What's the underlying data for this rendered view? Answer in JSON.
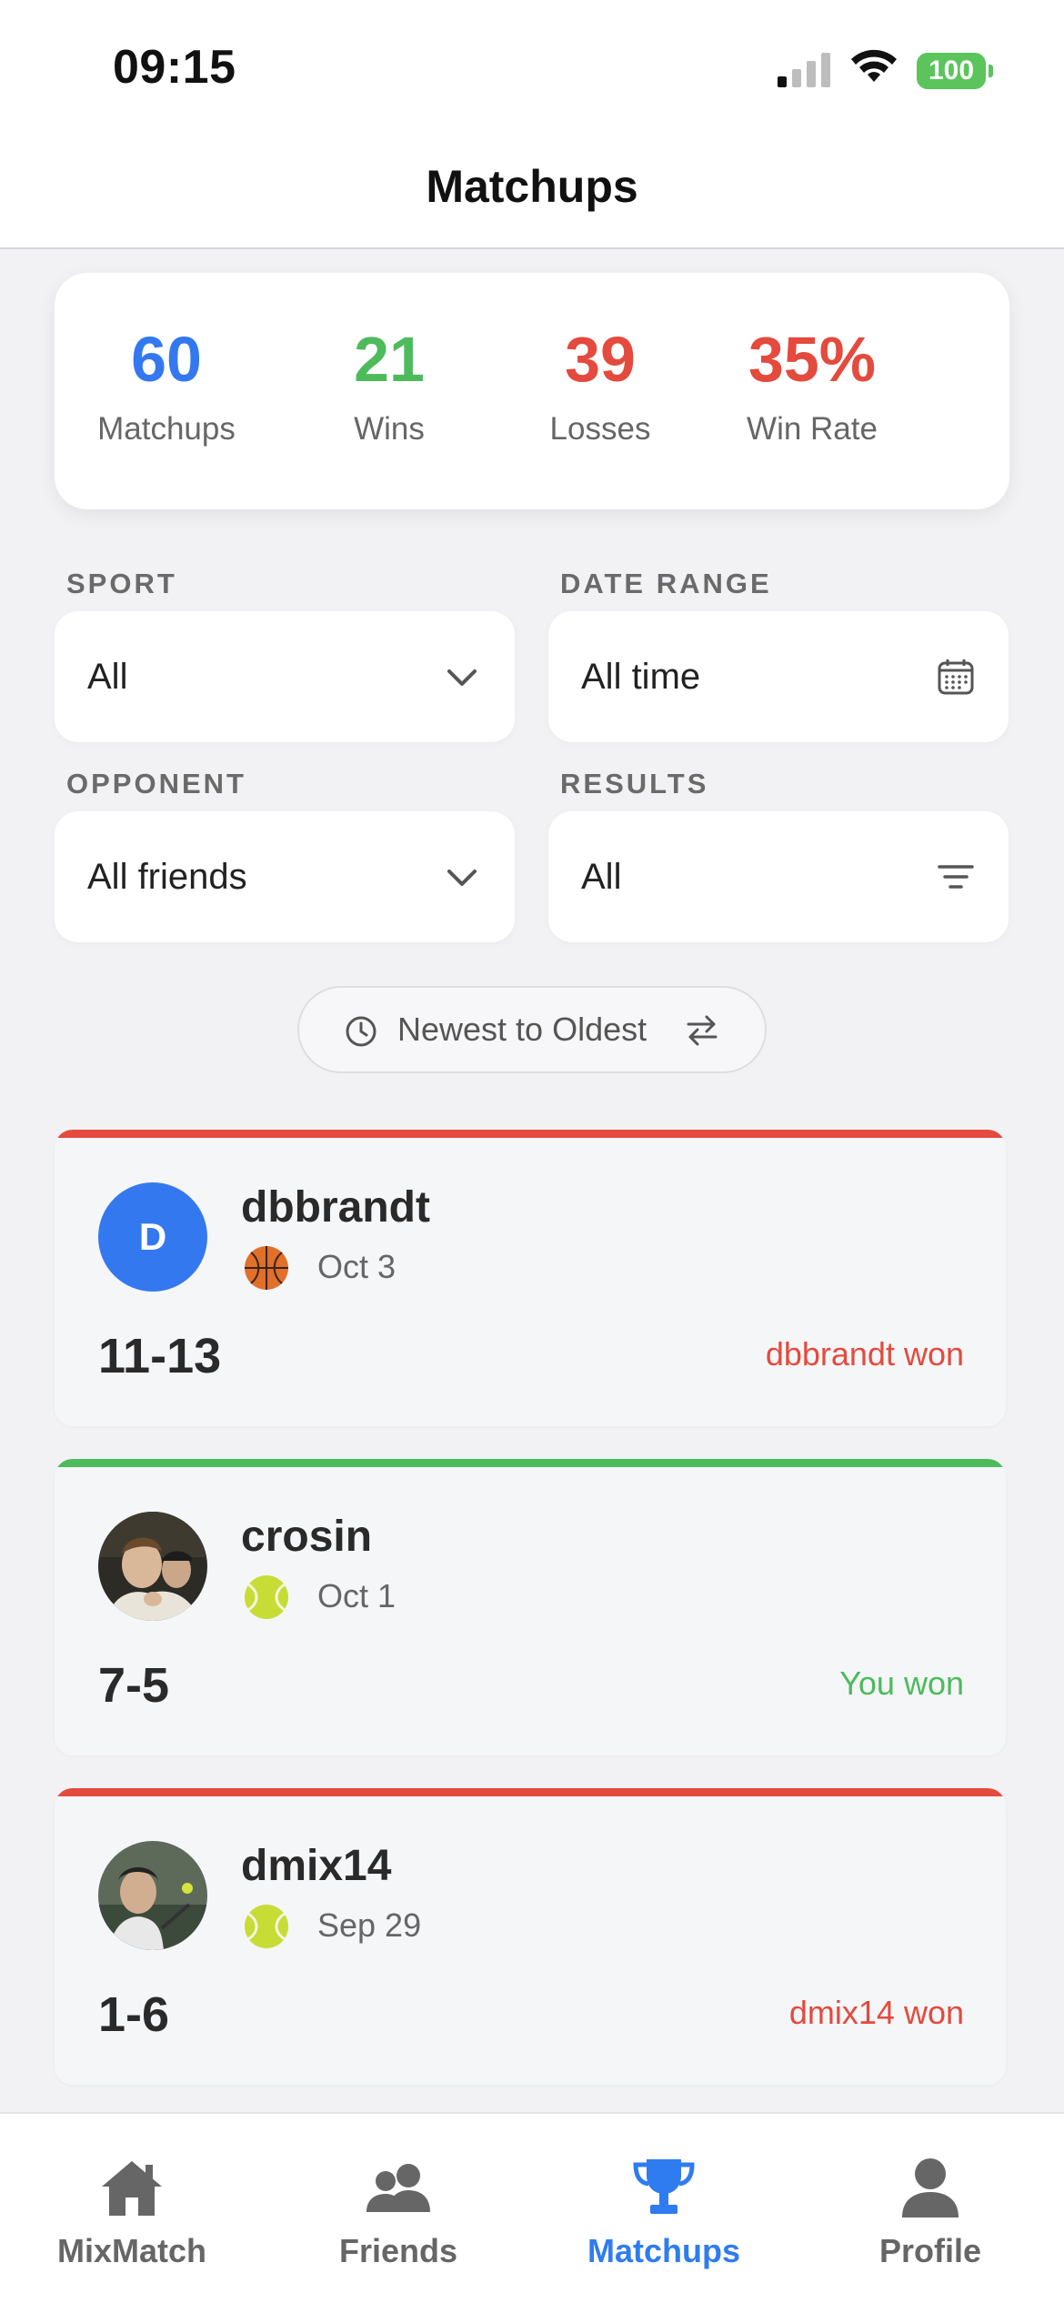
{
  "status_bar": {
    "time": "09:15",
    "battery": "100"
  },
  "header": {
    "title": "Matchups"
  },
  "stats": [
    {
      "value": "60",
      "label": "Matchups",
      "color": "#3478f0"
    },
    {
      "value": "21",
      "label": "Wins",
      "color": "#4dbb5b"
    },
    {
      "value": "39",
      "label": "Losses",
      "color": "#e44a3d"
    },
    {
      "value": "35%",
      "label": "Win Rate",
      "color": "#e44a3d"
    }
  ],
  "filters": {
    "sport": {
      "label": "SPORT",
      "value": "All",
      "icon": "chevron-down-icon"
    },
    "date_range": {
      "label": "DATE RANGE",
      "value": "All time",
      "icon": "calendar-icon"
    },
    "opponent": {
      "label": "OPPONENT",
      "value": "All friends",
      "icon": "chevron-down-icon"
    },
    "results": {
      "label": "RESULTS",
      "value": "All",
      "icon": "filter-icon"
    }
  },
  "sort": {
    "label": "Newest to Oldest"
  },
  "matches": [
    {
      "name": "dbbrandt",
      "initial": "D",
      "sport": "basketball",
      "date": "Oct 3",
      "score": "11-13",
      "result": "dbbrandt won",
      "outcome": "loss",
      "color": "#e44a3d"
    },
    {
      "name": "crosin",
      "sport": "tennis",
      "date": "Oct 1",
      "score": "7-5",
      "result": "You won",
      "outcome": "win",
      "color": "#4dbb5b"
    },
    {
      "name": "dmix14",
      "sport": "tennis",
      "date": "Sep 29",
      "score": "1-6",
      "result": "dmix14 won",
      "outcome": "loss",
      "color": "#e44a3d"
    }
  ],
  "tabbar": {
    "active": "Matchups",
    "items": [
      {
        "label": "MixMatch",
        "icon": "home-icon"
      },
      {
        "label": "Friends",
        "icon": "friends-icon"
      },
      {
        "label": "Matchups",
        "icon": "trophy-icon"
      },
      {
        "label": "Profile",
        "icon": "profile-icon"
      }
    ]
  }
}
